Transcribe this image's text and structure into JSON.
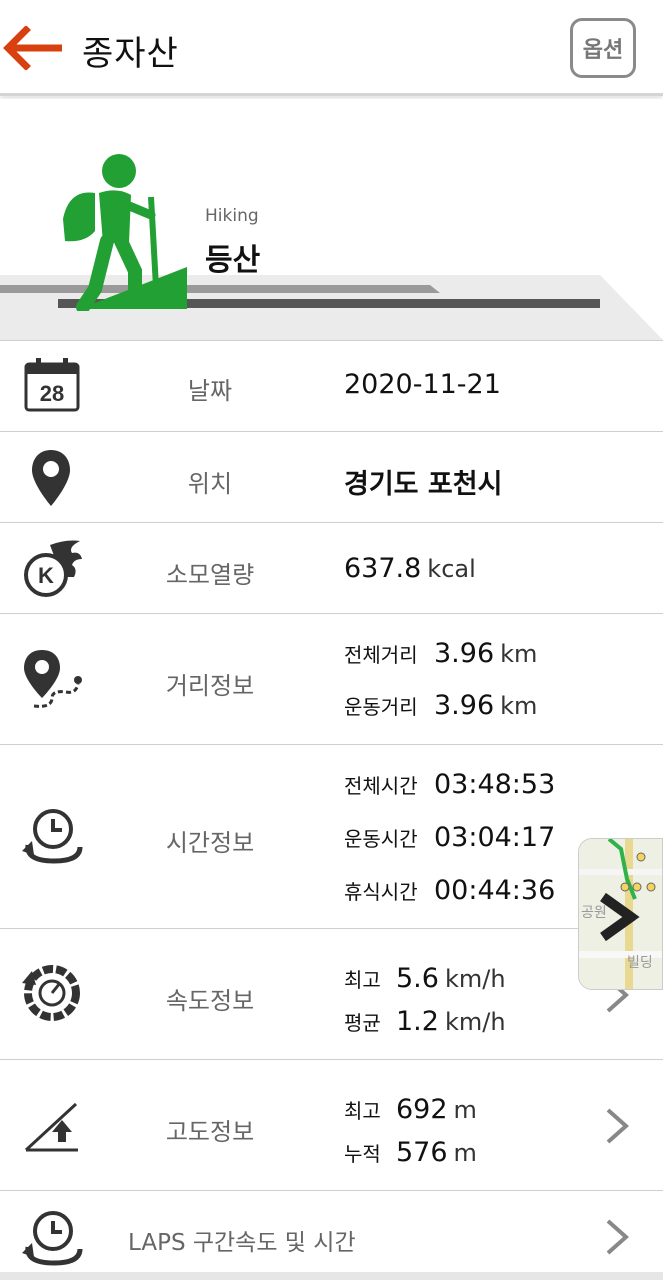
{
  "header": {
    "title": "종자산",
    "option_label": "옵션"
  },
  "hero": {
    "subtitle": "Hiking",
    "title": "등산"
  },
  "rows": {
    "date": {
      "label": "날짜",
      "value": "2020-11-21",
      "icon": "calendar-icon",
      "icon_text": "28"
    },
    "location": {
      "label": "위치",
      "value": "경기도 포천시",
      "icon": "location-pin-icon"
    },
    "calories": {
      "label": "소모열량",
      "value": "637.8",
      "unit": "kcal",
      "icon": "calorie-flame-icon",
      "icon_text": "K"
    },
    "distance": {
      "label": "거리정보",
      "icon": "route-pin-icon",
      "items": [
        {
          "label": "전체거리",
          "value": "3.96",
          "unit": "km"
        },
        {
          "label": "운동거리",
          "value": "3.96",
          "unit": "km"
        }
      ]
    },
    "time": {
      "label": "시간정보",
      "icon": "clock-loop-icon",
      "items": [
        {
          "label": "전체시간",
          "value": "03:48:53"
        },
        {
          "label": "운동시간",
          "value": "03:04:17"
        },
        {
          "label": "휴식시간",
          "value": "00:44:36"
        }
      ]
    },
    "speed": {
      "label": "속도정보",
      "icon": "speedometer-icon",
      "items": [
        {
          "label": "최고",
          "value": "5.6",
          "unit": "km/h"
        },
        {
          "label": "평균",
          "value": "1.2",
          "unit": "km/h"
        }
      ]
    },
    "altitude": {
      "label": "고도정보",
      "icon": "altitude-slope-icon",
      "items": [
        {
          "label": "최고",
          "value": "692",
          "unit": "m"
        },
        {
          "label": "누적",
          "value": "576",
          "unit": "m"
        }
      ]
    },
    "laps": {
      "label": "LAPS 구간속도 및 시간",
      "icon": "laps-clock-icon"
    }
  },
  "map_thumb": {
    "text": "공원",
    "text2": "빌딩"
  },
  "colors": {
    "accent": "#d9400f",
    "green": "#22a033"
  }
}
